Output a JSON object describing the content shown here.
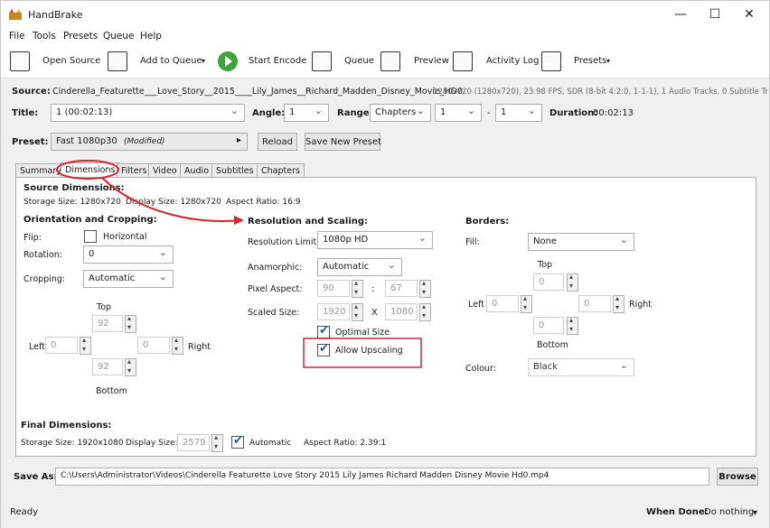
{
  "window": {
    "title": "HandBrake",
    "controls": [
      "—",
      "☐",
      "✕"
    ]
  },
  "menu": [
    "File",
    "Tools",
    "Presets",
    "Queue",
    "Help"
  ],
  "toolbar": {
    "open_source": "Open Source",
    "add_to_queue": "Add to Queue",
    "start_encode": "Start Encode",
    "queue": "Queue",
    "preview": "Preview",
    "activity_log": "Activity Log",
    "presets": "Presets",
    "caret": "▾"
  },
  "source": {
    "label": "Source:",
    "name": "Cinderella_Featurette___Love_Story__2015____Lily_James__Richard_Madden_Disney_Movie_HD0",
    "info": "1280x720 (1280x720), 23.98 FPS, SDR (8-bit 4:2:0, 1-1-1), 1 Audio Tracks, 0 Subtitle Tra"
  },
  "title_row": {
    "title_label": "Title:",
    "title_value": "1 (00:02:13)",
    "angle_label": "Angle:",
    "angle_value": "1",
    "range_label": "Range:",
    "range_type": "Chapters",
    "range_start": "1",
    "range_dash": "-",
    "range_end": "1",
    "duration_label": "Duration:",
    "duration_value": "00:02:13"
  },
  "preset_row": {
    "label": "Preset:",
    "value": "Fast 1080p30",
    "modified": "(Modified)",
    "arrow": "▸",
    "reload": "Reload",
    "save_new": "Save New Preset"
  },
  "tabs": [
    "Summary",
    "Dimensions",
    "Filters",
    "Video",
    "Audio",
    "Subtitles",
    "Chapters"
  ],
  "dimensions": {
    "source_heading": "Source Dimensions:",
    "storage_size": "Storage Size: 1280x720",
    "display_size": "Display Size: 1280x720",
    "aspect_ratio": "Aspect Ratio: 16:9",
    "orientation": {
      "heading": "Orientation and Cropping:",
      "flip_label": "Flip:",
      "horizontal": "Horizontal",
      "rotation_label": "Rotation:",
      "rotation_value": "0",
      "cropping_label": "Cropping:",
      "cropping_value": "Automatic",
      "top_label": "Top",
      "top_value": "92",
      "left_label": "Left",
      "left_value": "0",
      "right_value": "0",
      "right_label": "Right",
      "bottom_value": "92",
      "bottom_label": "Bottom"
    },
    "resolution": {
      "heading": "Resolution and Scaling:",
      "limit_label": "Resolution Limit:",
      "limit_value": "1080p HD",
      "anamorphic_label": "Anamorphic:",
      "anamorphic_value": "Automatic",
      "pixel_aspect_label": "Pixel Aspect:",
      "pixel_aspect_w": "90",
      "pixel_aspect_sep": ":",
      "pixel_aspect_h": "67",
      "scaled_label": "Scaled Size:",
      "scaled_w": "1920",
      "scaled_x": "X",
      "scaled_h": "1080",
      "optimal_size": "Optimal Size",
      "allow_upscaling": "Allow Upscaling"
    },
    "borders": {
      "heading": "Borders:",
      "fill_label": "Fill:",
      "fill_value": "None",
      "top_label": "Top",
      "top_value": "0",
      "left_label": "Left",
      "left_value": "0",
      "right_value": "0",
      "right_label": "Right",
      "bottom_value": "0",
      "bottom_label": "Bottom",
      "colour_label": "Colour:",
      "colour_value": "Black"
    },
    "final": {
      "heading": "Final Dimensions:",
      "storage_size": "Storage Size: 1920x1080",
      "display_size_label": "Display Size:",
      "display_size_value": "2579",
      "automatic": "Automatic",
      "aspect_ratio": "Aspect Ratio: 2.39:1"
    }
  },
  "save_as": {
    "label": "Save As:",
    "path": "C:\\Users\\Administrator\\Videos\\Cinderella Featurette  Love Story  2015   Lily James  Richard Madden Disney Movie Hd0.mp4",
    "browse": "Browse"
  },
  "status": {
    "text": "Ready",
    "when_done_label": "When Done:",
    "when_done_value": "Do nothing",
    "caret": "▾"
  },
  "colors": {
    "annotation": "#d9232e",
    "checkbox_blue": "#1d5fa8",
    "play_green": "#3fa43f"
  }
}
